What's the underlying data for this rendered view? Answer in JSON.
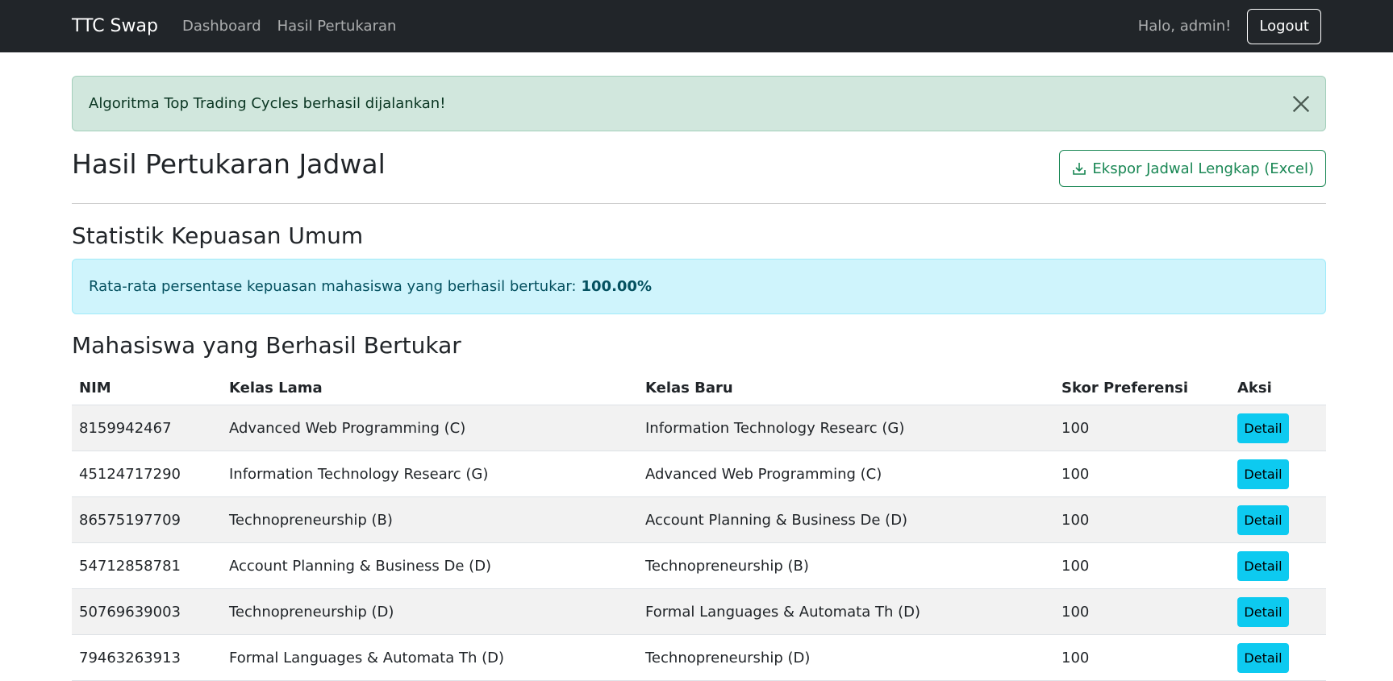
{
  "navbar": {
    "brand": "TTC Swap",
    "links": [
      "Dashboard",
      "Hasil Pertukaran"
    ],
    "greeting": "Halo, admin!",
    "logout_label": "Logout"
  },
  "alert_success": {
    "message": "Algoritma Top Trading Cycles berhasil dijalankan!"
  },
  "page": {
    "title": "Hasil Pertukaran Jadwal",
    "export_label": "Ekspor Jadwal Lengkap (Excel)"
  },
  "stats": {
    "title": "Statistik Kepuasan Umum",
    "text": "Rata-rata persentase kepuasan mahasiswa yang berhasil bertukar:",
    "value": "100.00%"
  },
  "table": {
    "title": "Mahasiswa yang Berhasil Bertukar",
    "headers": [
      "NIM",
      "Kelas Lama",
      "Kelas Baru",
      "Skor Preferensi",
      "Aksi"
    ],
    "detail_label": "Detail",
    "rows": [
      {
        "nim": "8159942467",
        "old": "Advanced Web Programming (C)",
        "new": "Information Technology Researc (G)",
        "score": "100"
      },
      {
        "nim": "45124717290",
        "old": "Information Technology Researc (G)",
        "new": "Advanced Web Programming (C)",
        "score": "100"
      },
      {
        "nim": "86575197709",
        "old": "Technopreneurship (B)",
        "new": "Account Planning & Business De (D)",
        "score": "100"
      },
      {
        "nim": "54712858781",
        "old": "Account Planning & Business De (D)",
        "new": "Technopreneurship (B)",
        "score": "100"
      },
      {
        "nim": "50769639003",
        "old": "Technopreneurship (D)",
        "new": "Formal Languages & Automata Th (D)",
        "score": "100"
      },
      {
        "nim": "79463263913",
        "old": "Formal Languages & Automata Th (D)",
        "new": "Technopreneurship (D)",
        "score": "100"
      }
    ]
  },
  "colors": {
    "navbar": "#212529",
    "success": "#198754",
    "info": "#0dcaf0"
  },
  "icons": {
    "close": "close-icon",
    "download": "download-icon"
  }
}
